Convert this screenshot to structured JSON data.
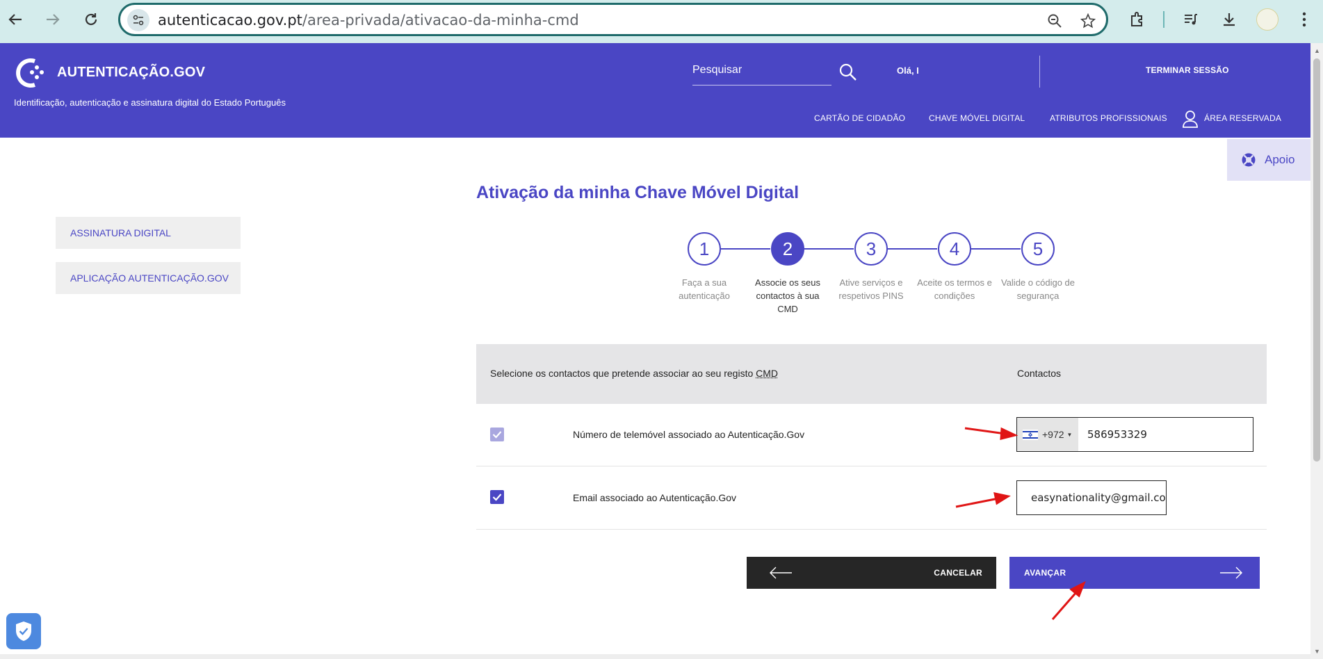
{
  "browser": {
    "url_host": "autenticacao.gov.pt",
    "url_path": "/area-privada/ativacao-da-minha-cmd"
  },
  "header": {
    "logo_text": "AUTENTICAÇÃO.GOV",
    "tagline": "Identificação, autenticação e assinatura digital do Estado Português",
    "search_label": "Pesquisar",
    "greeting": "Olá, I",
    "logout": "TERMINAR SESSÃO",
    "nav": {
      "cartao": "CARTÃO DE CIDADÃO",
      "chave": "CHAVE MÓVEL DIGITAL",
      "atributos": "ATRIBUTOS PROFISSIONAIS",
      "area": "ÁREA RESERVADA"
    },
    "brand_color": "#4a46c4"
  },
  "help": {
    "label": "Apoio"
  },
  "sidebar": {
    "items": [
      {
        "label": "ASSINATURA DIGITAL"
      },
      {
        "label": "APLICAÇÃO AUTENTICAÇÃO.GOV"
      }
    ]
  },
  "main": {
    "title": "Ativação da minha Chave Móvel Digital",
    "steps": [
      {
        "number": "1",
        "line1": "Faça a sua",
        "line2": "autenticação",
        "line3": ""
      },
      {
        "number": "2",
        "line1": "Associe os seus",
        "line2": "contactos à sua",
        "line3": "CMD"
      },
      {
        "number": "3",
        "line1": "Ative serviços e",
        "line2": "respetivos PINS",
        "line3": ""
      },
      {
        "number": "4",
        "line1": "Aceite os termos e",
        "line2": "condições",
        "line3": ""
      },
      {
        "number": "5",
        "line1": "Valide o código de",
        "line2": "segurança",
        "line3": ""
      }
    ],
    "active_step": 2,
    "table": {
      "header_left_pre": "Selecione os contactos que pretende associar ao seu registo ",
      "header_left_abbr": "CMD",
      "header_right": "Contactos",
      "rows": [
        {
          "label": "Número de telemóvel associado ao Autenticação.Gov",
          "checked": true,
          "disabled": true
        },
        {
          "label": "Email associado ao Autenticação.Gov",
          "checked": true,
          "disabled": false
        }
      ],
      "phone": {
        "dial_code": "+972",
        "number": "586953329",
        "flag": "israel-flag-icon"
      },
      "email": {
        "value": "easynationality@gmail.com"
      }
    },
    "buttons": {
      "cancel": "CANCELAR",
      "next": "AVANÇAR"
    }
  }
}
